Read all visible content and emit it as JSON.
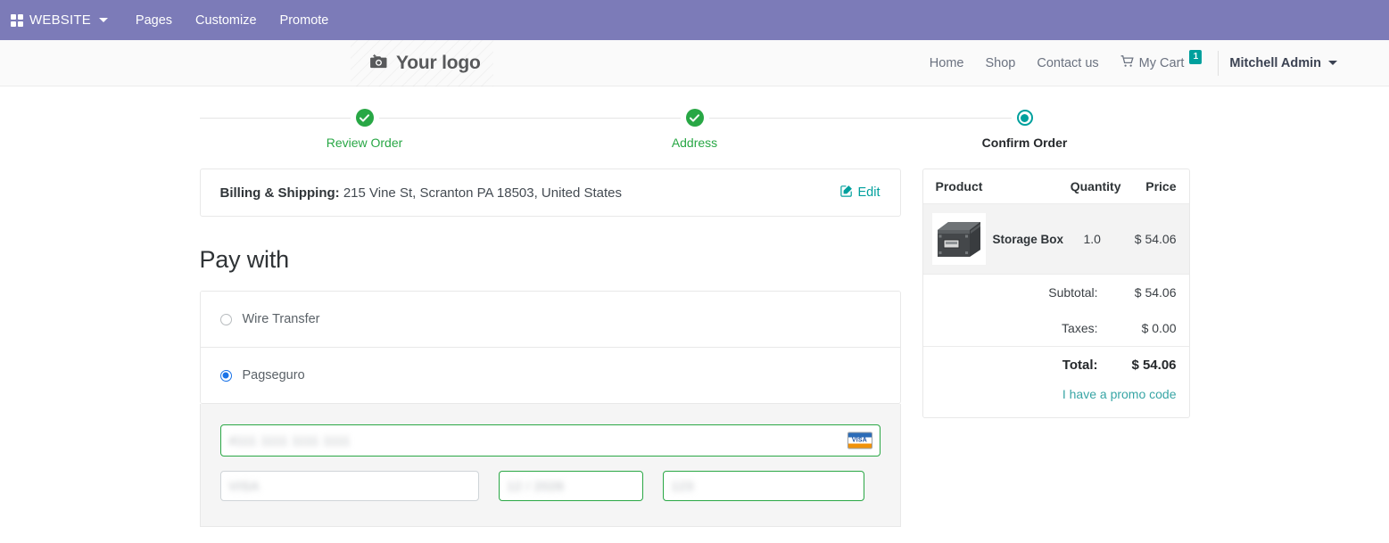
{
  "editor_bar": {
    "brand": {
      "icon": "apps-grid-icon",
      "label": "WEBSITE"
    },
    "menu": [
      {
        "label": "Pages"
      },
      {
        "label": "Customize"
      },
      {
        "label": "Promote"
      }
    ]
  },
  "site_header": {
    "logo": {
      "icon": "camera-icon",
      "text": "Your logo"
    },
    "nav": [
      {
        "label": "Home"
      },
      {
        "label": "Shop"
      },
      {
        "label": "Contact us"
      }
    ],
    "cart": {
      "icon": "shopping-cart-icon",
      "label": "My Cart",
      "count": "1"
    },
    "user": {
      "name": "Mitchell Admin",
      "icon": "chevron-down-icon"
    }
  },
  "stepper": {
    "steps": [
      {
        "label": "Review Order",
        "state": "done"
      },
      {
        "label": "Address",
        "state": "done"
      },
      {
        "label": "Confirm Order",
        "state": "current"
      }
    ]
  },
  "address": {
    "label": "Billing & Shipping:",
    "value": "215 Vine St, Scranton PA 18503, United States",
    "edit_label": "Edit",
    "edit_icon": "pencil-square-icon"
  },
  "payment": {
    "title": "Pay with",
    "options": [
      {
        "label": "Wire Transfer",
        "selected": false
      },
      {
        "label": "Pagseguro",
        "selected": true
      }
    ],
    "card_form": {
      "card_number": {
        "value": "4111 1111 1111 1111",
        "redacted": true,
        "brand_icon": "visa-card-icon",
        "brand_label": "VISA",
        "state": "valid"
      },
      "card_holder": {
        "value": "VISA",
        "redacted": true,
        "state": "default"
      },
      "expiry": {
        "value": "12 / 2026",
        "redacted": true,
        "state": "valid"
      },
      "cvc": {
        "value": "123",
        "redacted": true,
        "state": "valid"
      }
    }
  },
  "summary": {
    "columns": {
      "product": "Product",
      "quantity": "Quantity",
      "price": "Price"
    },
    "items": [
      {
        "name": "Storage Box",
        "quantity": "1.0",
        "price": "$ 54.06",
        "image": "storage-box-thumbnail"
      }
    ],
    "lines": [
      {
        "label": "Subtotal:",
        "value": "$ 54.06"
      },
      {
        "label": "Taxes:",
        "value": "$ 0.00"
      }
    ],
    "total": {
      "label": "Total:",
      "value": "$ 54.06"
    },
    "promo_link": "I have a promo code"
  },
  "colors": {
    "editor_bar": "#7c7bb8",
    "accent_teal": "#00a09d",
    "success_green": "#28a745",
    "radio_blue": "#1a73e8",
    "valid_border": "#2aa745"
  }
}
